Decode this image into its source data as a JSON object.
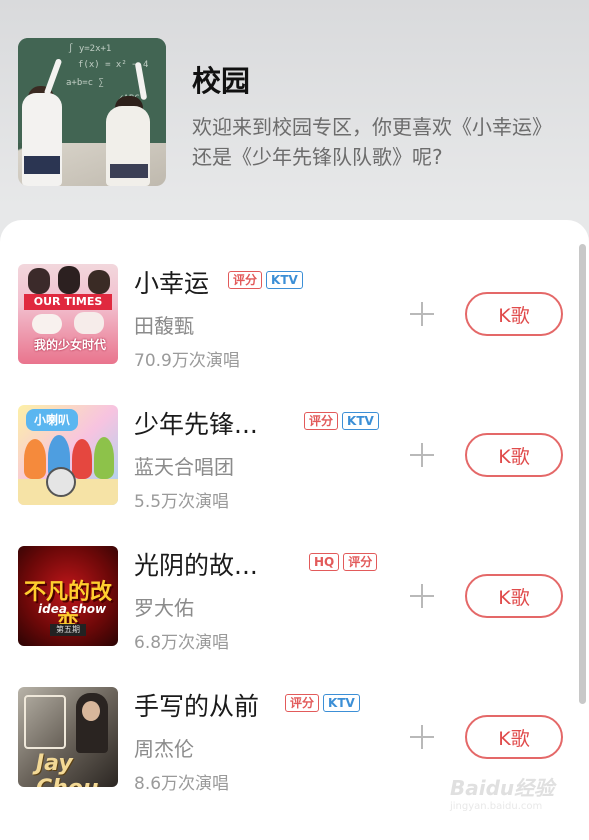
{
  "header": {
    "title": "校园",
    "description": "欢迎来到校园专区，你更喜欢《小幸运》还是《少年先锋队队歌》呢?"
  },
  "songs": [
    {
      "title": "小幸运",
      "tags": [
        {
          "label": "评分",
          "color": "red"
        },
        {
          "label": "KTV",
          "color": "blue"
        }
      ],
      "artist": "田馥甄",
      "plays": "70.9万次演唱",
      "button": "K歌",
      "cover_text": [
        "OUR TIMES",
        "我的少女时代"
      ]
    },
    {
      "title": "少年先锋...",
      "tags": [
        {
          "label": "评分",
          "color": "red"
        },
        {
          "label": "KTV",
          "color": "blue"
        }
      ],
      "artist": "蓝天合唱团",
      "plays": "5.5万次演唱",
      "button": "K歌",
      "cover_text": [
        "小喇叭"
      ]
    },
    {
      "title": "光阴的故...",
      "tags": [
        {
          "label": "HQ",
          "color": "red"
        },
        {
          "label": "评分",
          "color": "red"
        }
      ],
      "artist": "罗大佑",
      "plays": "6.8万次演唱",
      "button": "K歌",
      "cover_text": [
        "不凡的改变",
        "idea show",
        "第五期"
      ]
    },
    {
      "title": "手写的从前",
      "tags": [
        {
          "label": "评分",
          "color": "red"
        },
        {
          "label": "KTV",
          "color": "blue"
        }
      ],
      "artist": "周杰伦",
      "plays": "8.6万次演唱",
      "button": "K歌",
      "cover_text": [
        "Jay Chou"
      ]
    }
  ],
  "watermark": {
    "text": "Baidu经验",
    "sub": "jingyan.baidu.com"
  }
}
